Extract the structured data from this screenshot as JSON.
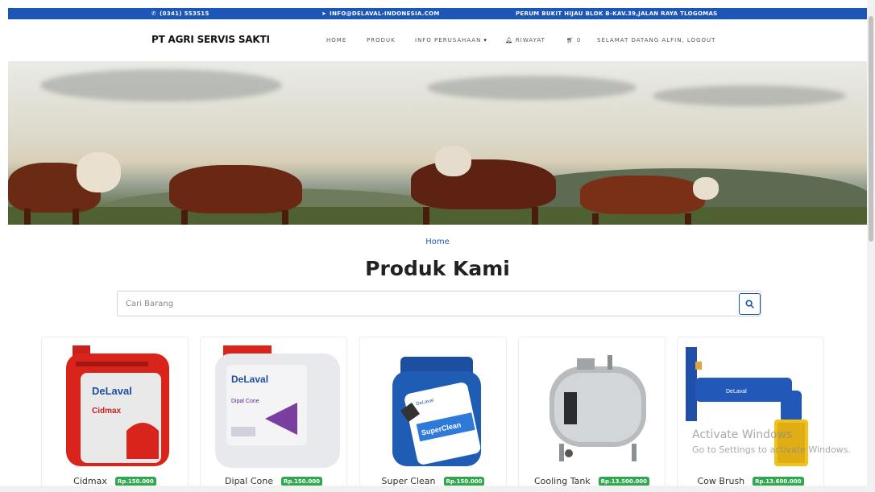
{
  "topbar": {
    "phone": "(0341) 553515",
    "email": "INFO@DELAVAL-INDONESIA.COM",
    "address": "PERUM BUKIT HIJAU BLOK B-KAV.39,JALAN RAYA TLOGOMAS",
    "bg_color": "#1c57b8"
  },
  "navbar": {
    "brand": "PT AGRI SERVIS SAKTI",
    "items": {
      "home": "HOME",
      "produk": "PRODUK",
      "info": "INFO PERUSAHAAN",
      "riwayat": "RIWAYAT",
      "cart_count": "0",
      "user": "SELAMAT DATANG ALFIN, LOGOUT"
    }
  },
  "breadcrumb": "Home",
  "heading": "Produk Kami",
  "search": {
    "placeholder": "Cari Barang",
    "value": ""
  },
  "products": [
    {
      "name": "Cidmax",
      "price": "Rp.150.000",
      "brand": "DeLaval",
      "label": "Cidmax"
    },
    {
      "name": "Dipal Cone",
      "price": "Rp.150.000",
      "brand": "DeLaval",
      "label": "Dipal Cone"
    },
    {
      "name": "Super Clean",
      "price": "Rp.150.000",
      "brand": "DeLaval",
      "label": "SuperClean"
    },
    {
      "name": "Cooling Tank",
      "price": "Rp.13.500.000",
      "brand": "",
      "label": ""
    },
    {
      "name": "Cow Brush",
      "price": "Rp.13.600.000",
      "brand": "DeLaval",
      "label": ""
    }
  ],
  "watermark": {
    "line1": "Activate Windows",
    "line2": "Go to Settings to activate Windows."
  },
  "colors": {
    "accent": "#1c57b8",
    "price_badge": "#2fa84f"
  }
}
